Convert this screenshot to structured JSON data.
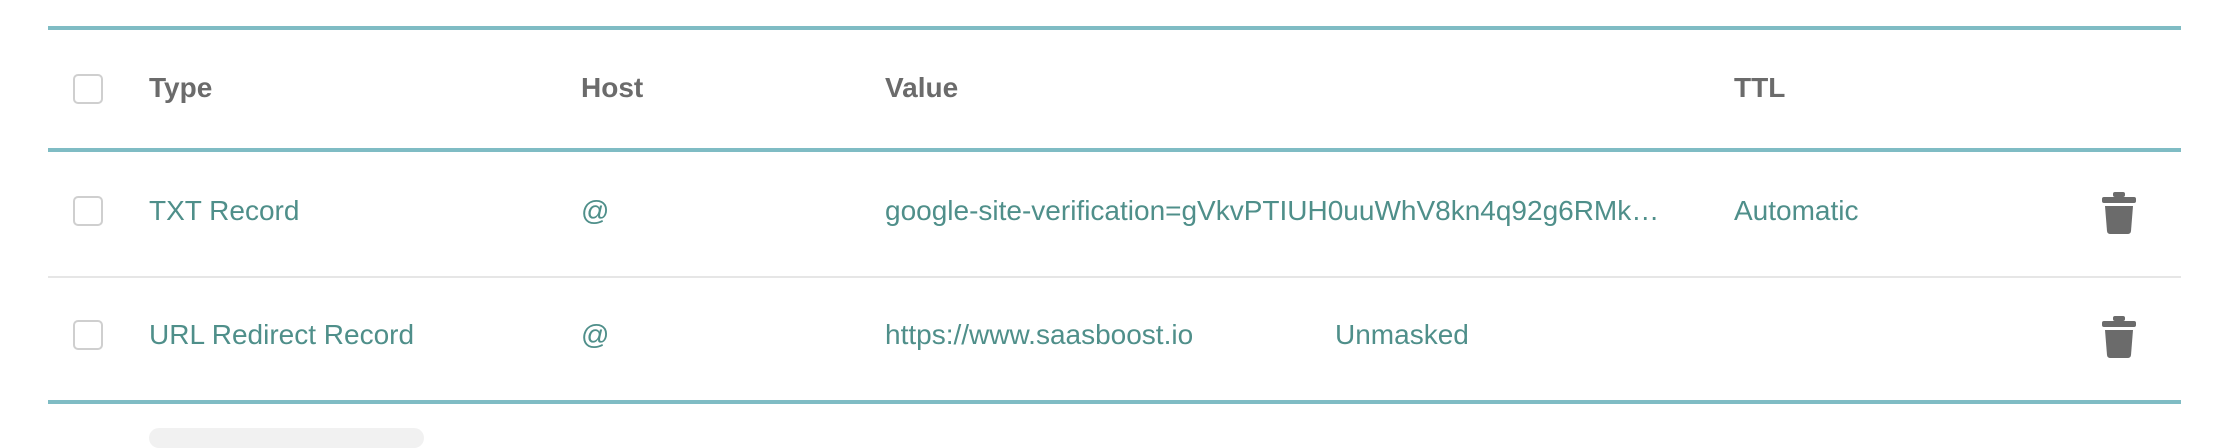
{
  "header": {
    "type_label": "Type",
    "host_label": "Host",
    "value_label": "Value",
    "ttl_label": "TTL"
  },
  "records": [
    {
      "type": "TXT Record",
      "host": "@",
      "value": "google-site-verification=gVkvPTIUH0uuWhV8kn4q92g6RMk…",
      "extra": "",
      "ttl": "Automatic"
    },
    {
      "type": "URL Redirect Record",
      "host": "@",
      "value": "https://www.saasboost.io",
      "extra": "Unmasked",
      "ttl": ""
    }
  ],
  "icons": {
    "delete": "trash-icon"
  },
  "colors": {
    "accent_rule": "#7fbcc4",
    "link_text": "#4f8f8a",
    "header_text": "#6b6b6b",
    "icon": "#6b6b6b"
  }
}
